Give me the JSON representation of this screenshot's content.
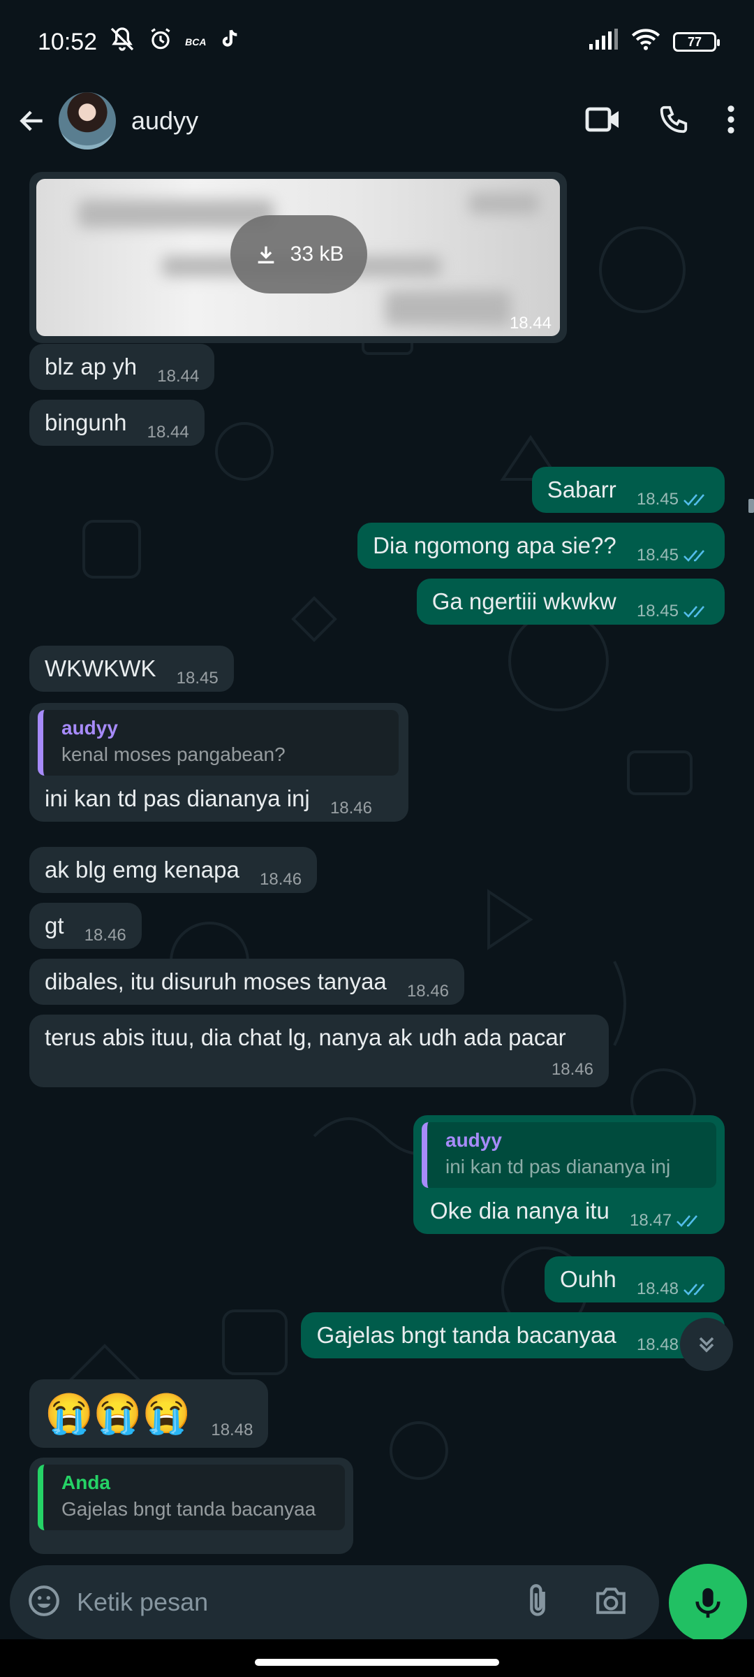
{
  "status_bar": {
    "time": "10:52",
    "badge_text": "BCA",
    "battery": "77",
    "icons": [
      "mute-icon",
      "alarm-icon",
      "bca-icon",
      "tiktok-icon",
      "signal-icon",
      "wifi-icon",
      "battery-icon"
    ]
  },
  "header": {
    "contact_name": "audyy",
    "icons": [
      "back-arrow-icon",
      "video-call-icon",
      "voice-call-icon",
      "more-vert-icon"
    ]
  },
  "messages": [
    {
      "kind": "image",
      "direction": "in",
      "file_size": "33 kB",
      "time": "18.44"
    },
    {
      "direction": "in",
      "text": "blz ap yh",
      "time": "18.44"
    },
    {
      "direction": "in",
      "text": "bingunh",
      "time": "18.44"
    },
    {
      "direction": "out",
      "text": "Sabarr",
      "time": "18.45",
      "status": "read"
    },
    {
      "direction": "out",
      "text": "Dia ngomong apa sie??",
      "time": "18.45",
      "status": "read"
    },
    {
      "direction": "out",
      "text": "Ga ngertiii wkwkw",
      "time": "18.45",
      "status": "read"
    },
    {
      "direction": "in",
      "text": "WKWKWK",
      "time": "18.45"
    },
    {
      "direction": "in",
      "quote_name": "audyy",
      "quote_text": "kenal moses pangabean?",
      "text": "ini kan td pas diananya inj",
      "time": "18.46"
    },
    {
      "direction": "in",
      "text": "ak blg emg kenapa",
      "time": "18.46"
    },
    {
      "direction": "in",
      "text": "gt",
      "time": "18.46"
    },
    {
      "direction": "in",
      "text": "dibales, itu disuruh moses tanyaa",
      "time": "18.46"
    },
    {
      "direction": "in",
      "text": "terus abis ituu, dia chat lg, nanya ak udh ada pacar",
      "time": "18.46"
    },
    {
      "direction": "out",
      "quote_name": "audyy",
      "quote_text": "ini kan td pas diananya inj",
      "text": "Oke dia nanya itu",
      "time": "18.47",
      "status": "read"
    },
    {
      "direction": "out",
      "text": "Ouhh",
      "time": "18.48",
      "status": "read"
    },
    {
      "direction": "out",
      "text": "Gajelas bngt tanda bacanyaa",
      "time": "18.48",
      "status": "read"
    },
    {
      "direction": "in",
      "text": "😭😭😭",
      "time": "18.48"
    },
    {
      "direction": "in",
      "quote_name": "Anda",
      "quote_text": "Gajelas bngt tanda bacanyaa"
    }
  ],
  "composer": {
    "placeholder": "Ketik pesan",
    "icons": [
      "emoji-icon",
      "attach-icon",
      "camera-icon",
      "mic-icon"
    ]
  },
  "colors": {
    "background": "#0b141a",
    "incoming_bubble": "#202c33",
    "outgoing_bubble": "#005c4b",
    "read_tick": "#53bdeb",
    "accent_green": "#21c063",
    "quote_purple": "#a78bfa"
  }
}
